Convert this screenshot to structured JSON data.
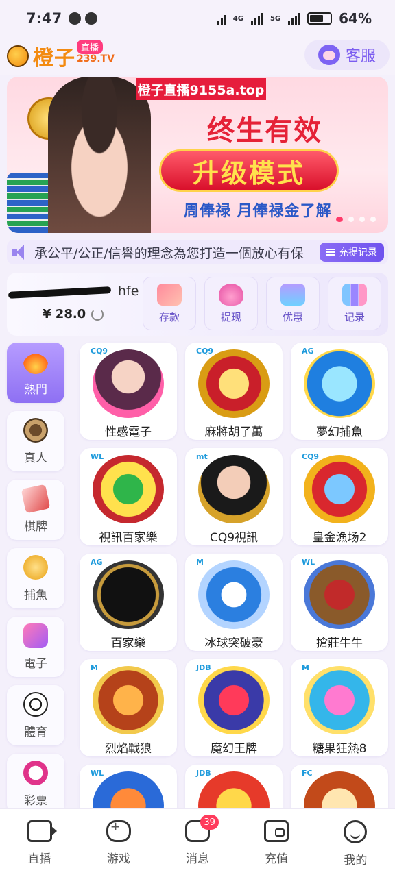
{
  "status_bar": {
    "time": "7:47",
    "network_4g": "4G",
    "network_5g": "5G",
    "battery": "64%"
  },
  "header": {
    "logo_text": "橙子",
    "logo_badge": "直播",
    "logo_domain": "239.TV",
    "service_label": "客服"
  },
  "banner": {
    "top_label": "橙子直播9155a.top",
    "slogan": "终生有效",
    "mode_button": "升级模式",
    "bonus_text": "周俸禄 月俸禄金了解",
    "active_slide": 1,
    "total_slides": 4
  },
  "notice": {
    "text": "承公平/公正/信譽的理念為您打造一個放心有保",
    "recharge_record_label": "充提记录"
  },
  "account": {
    "name": "hfe",
    "balance": "¥ 28.0",
    "actions": [
      {
        "label": "存款",
        "icon": "card-icon"
      },
      {
        "label": "提现",
        "icon": "money-bag-icon"
      },
      {
        "label": "优惠",
        "icon": "gift-icon"
      },
      {
        "label": "记录",
        "icon": "bar-chart-icon"
      }
    ]
  },
  "categories": [
    {
      "label": "熱門",
      "icon": "fire-icon",
      "active": true
    },
    {
      "label": "真人",
      "icon": "casino-chip-icon",
      "active": false
    },
    {
      "label": "棋牌",
      "icon": "playing-card-icon",
      "active": false
    },
    {
      "label": "捕魚",
      "icon": "fish-icon",
      "active": false
    },
    {
      "label": "電子",
      "icon": "slot-icon",
      "active": false
    },
    {
      "label": "體育",
      "icon": "soccer-ball-icon",
      "active": false
    },
    {
      "label": "彩票",
      "icon": "lottery-ball-icon",
      "active": false
    }
  ],
  "games": [
    {
      "name": "性感電子",
      "provider": "CQ9"
    },
    {
      "name": "麻將胡了萬",
      "provider": "CQ9"
    },
    {
      "name": "夢幻捕魚",
      "provider": "AG"
    },
    {
      "name": "視訊百家樂",
      "provider": "WL"
    },
    {
      "name": "CQ9視訊",
      "provider": "mt"
    },
    {
      "name": "皇金漁场2",
      "provider": "CQ9"
    },
    {
      "name": "百家樂",
      "provider": "AG"
    },
    {
      "name": "冰球突破豪",
      "provider": "M"
    },
    {
      "name": "搶莊牛牛",
      "provider": "WL"
    },
    {
      "name": "烈焰戰狼",
      "provider": "M"
    },
    {
      "name": "魔幻王牌",
      "provider": "JDB"
    },
    {
      "name": "糖果狂熱8",
      "provider": "M"
    },
    {
      "name": "",
      "provider": "WL"
    },
    {
      "name": "",
      "provider": "JDB"
    },
    {
      "name": "",
      "provider": "FC"
    }
  ],
  "bottom_nav": [
    {
      "label": "直播",
      "icon": "live-camera-icon"
    },
    {
      "label": "游戏",
      "icon": "gamepad-icon"
    },
    {
      "label": "消息",
      "icon": "message-icon",
      "badge": "39"
    },
    {
      "label": "充值",
      "icon": "wallet-icon"
    },
    {
      "label": "我的",
      "icon": "profile-icon"
    }
  ]
}
